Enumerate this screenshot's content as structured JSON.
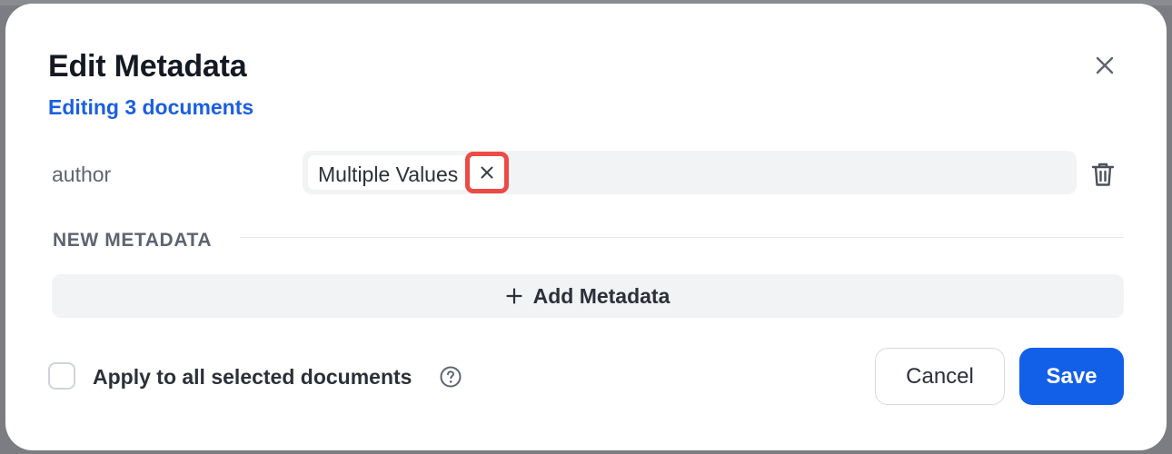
{
  "dialog": {
    "title": "Edit Metadata",
    "subtitle": "Editing 3 documents"
  },
  "fields": [
    {
      "label": "author",
      "chip_value": "Multiple Values"
    }
  ],
  "new_metadata": {
    "section_label": "NEW METADATA",
    "add_button_label": "Add Metadata"
  },
  "footer": {
    "apply_all_label": "Apply to all selected documents",
    "apply_all_checked": false,
    "cancel_label": "Cancel",
    "save_label": "Save"
  },
  "colors": {
    "accent": "#1360e8",
    "link": "#1b5fe0",
    "highlight": "#ec4a45"
  },
  "icons": [
    "close-icon",
    "chip-remove-icon",
    "trash-icon",
    "plus-icon",
    "help-circle-icon"
  ]
}
